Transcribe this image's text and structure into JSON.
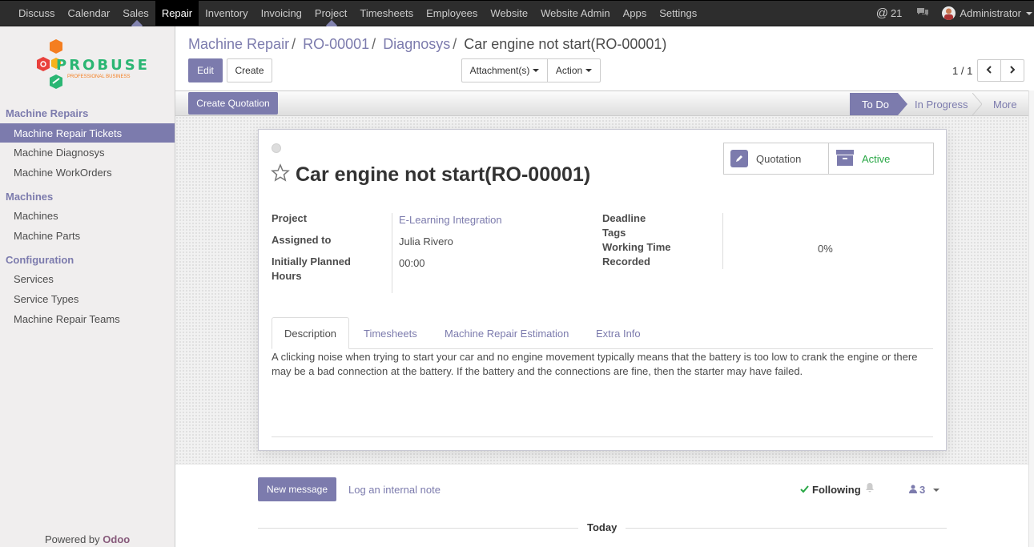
{
  "top_menu": {
    "items": [
      "Discuss",
      "Calendar",
      "Sales",
      "Repair",
      "Inventory",
      "Invoicing",
      "Project",
      "Timesheets",
      "Employees",
      "Website",
      "Website Admin",
      "Apps",
      "Settings"
    ],
    "active_item": "Repair",
    "notification_count": "21",
    "user_name": "Administrator"
  },
  "sidebar": {
    "logo_text": "PROBUSE",
    "logo_subtext": "PROFESSIONAL BUSINESS",
    "sections": [
      {
        "title": "Machine Repairs",
        "items": [
          "Machine Repair Tickets",
          "Machine Diagnosys",
          "Machine WorkOrders"
        ]
      },
      {
        "title": "Machines",
        "items": [
          "Machines",
          "Machine Parts"
        ]
      },
      {
        "title": "Configuration",
        "items": [
          "Services",
          "Service Types",
          "Machine Repair Teams"
        ]
      }
    ],
    "active_item": "Machine Repair Tickets",
    "powered_by": "Powered by",
    "powered_brand": "Odoo"
  },
  "breadcrumb": [
    "Machine Repair",
    "RO-00001",
    "Diagnosys",
    "Car engine not start(RO-00001)"
  ],
  "buttons": {
    "edit": "Edit",
    "create": "Create",
    "attachments": "Attachment(s)",
    "action": "Action",
    "create_quotation": "Create Quotation"
  },
  "pager": {
    "text": "1 / 1"
  },
  "stages": {
    "todo": "To Do",
    "in_progress": "In Progress",
    "more": "More",
    "current": "To Do"
  },
  "record": {
    "title": "Car engine not start(RO-00001)",
    "smart_buttons": {
      "quotation": "Quotation",
      "active": "Active"
    },
    "fields": {
      "project_label": "Project",
      "project_value": "E-Learning Integration",
      "assigned_label": "Assigned to",
      "assigned_value": "Julia Rivero",
      "planned_label_1": "Initially Planned",
      "planned_label_2": "Hours",
      "planned_value": "00:00",
      "deadline_label": "Deadline",
      "tags_label": "Tags",
      "working_label_1": "Working Time",
      "working_label_2": "Recorded",
      "working_value": "0%"
    },
    "tabs": [
      "Description",
      "Timesheets",
      "Machine Repair Estimation",
      "Extra Info"
    ],
    "active_tab": "Description",
    "description_line1": "A clicking noise when trying to start your car and no engine movement typically means that the battery is too low to crank the engine or there",
    "description_line2": "may be a bad connection at the battery. If the battery and the connections are fine, then the starter may have failed."
  },
  "chatter": {
    "new_message": "New message",
    "log_note": "Log an internal note",
    "following": "Following",
    "followers_count": "3",
    "today": "Today"
  },
  "colors": {
    "accent": "#7c7bad",
    "topbar": "#2d2d2d",
    "active_green": "#28a745"
  }
}
